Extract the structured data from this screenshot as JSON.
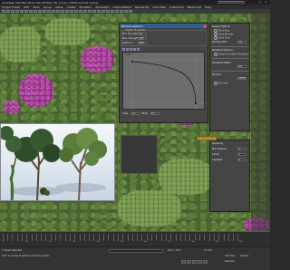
{
  "window": {
    "title": "Autodesk 3ds Max 2014 x64    Untitled_3D_scene  1 [Particle Flow scene]",
    "search_placeholder": "Type a keyword or phrase",
    "controls": [
      "_",
      "□",
      "×"
    ]
  },
  "menu": [
    "Project Folder",
    "Edit",
    "Tools",
    "Group",
    "Views",
    "Create",
    "Modifiers",
    "Animation",
    "Graph Editors",
    "Rendering",
    "Civil View",
    "Customize",
    "MAXScript",
    "Help"
  ],
  "dialog": {
    "title": "Particle Options",
    "close": "×",
    "group_label": "Growth Properties",
    "rows": [
      {
        "label": "Min. Strength:",
        "value": "0.0"
      },
      {
        "label": "Max. Strength:",
        "value": "10.0"
      },
      {
        "label": "Distance:",
        "value": "60.0"
      }
    ],
    "curve_label": "Falloff",
    "bottom": [
      "Scale:",
      "1.0",
      "Offset:",
      "0.0"
    ]
  },
  "cmdpanel": {
    "title1": "Display Options",
    "opts1": [
      "Show Strip",
      "Show Normals",
      "Show Ticks"
    ],
    "field1_label": "Spacing Dist:",
    "field1_value": "1.0",
    "title2": "Persistent Options",
    "opt2": "Disable Persistent Simulation",
    "title3": "Persistent Offset",
    "field3_value": "0.0",
    "title4": "Random",
    "field4_value": "12345",
    "opt4": "Use Seed"
  },
  "panel2": {
    "title": "Spawning",
    "rows": [
      {
        "label": "Max Spawns:",
        "value": "3"
      },
      {
        "label": "Count:",
        "value": "1"
      },
      {
        "label": "Lag Rate:",
        "value": "0"
      }
    ]
  },
  "viewport_label": "PF Source 001",
  "timeline": {
    "labels": [
      "0",
      "10",
      "20",
      "30",
      "40",
      "50",
      "60",
      "70",
      "80",
      "90",
      "100"
    ]
  },
  "status": {
    "selected": "1 Object Selected",
    "prompt": "Click and drag to select and move objects",
    "frame": "0 / 100",
    "grid": "Grid = 10.0",
    "autokey": "Auto Key",
    "setkey": "Set Key",
    "selected_dd": "Selected"
  },
  "colors": {
    "accent": "#2f5f8f",
    "viewport_foliage": "#476333",
    "flowers": "#c04bb8",
    "label_highlight": "#caa23a"
  }
}
